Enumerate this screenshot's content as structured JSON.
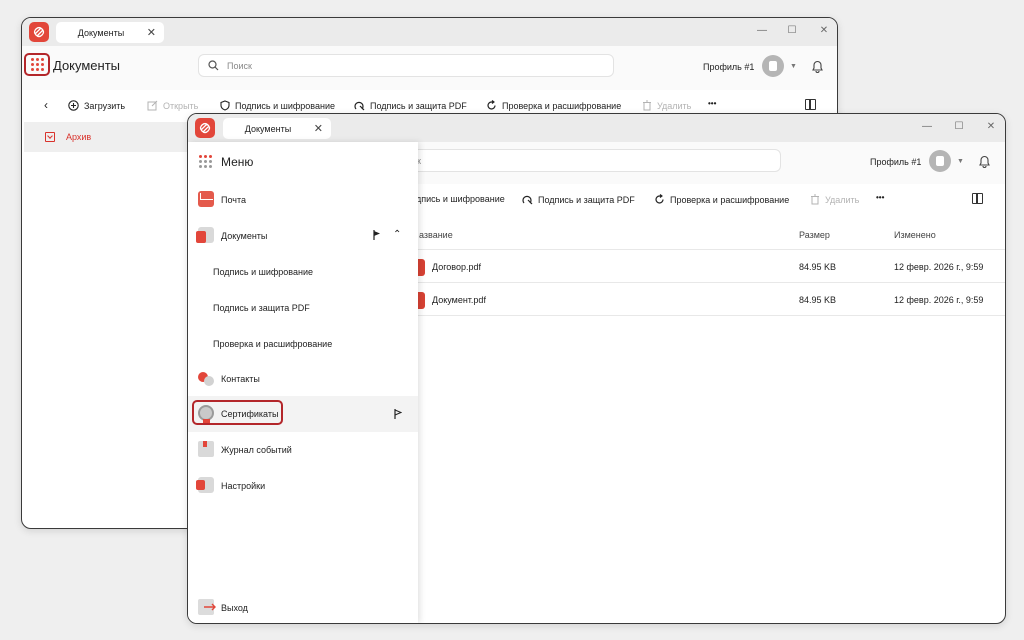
{
  "colors": {
    "accent": "#e2463a",
    "highlight": "#b3262a",
    "text": "#222222",
    "disabled": "#b3b3b3"
  },
  "back_window": {
    "tab": {
      "label": "Документы",
      "close": "✕"
    },
    "window_controls": {
      "minimize": "—",
      "maximize": "☐",
      "close": "✕"
    },
    "header": {
      "menu_icon": "grid-icon",
      "title": "Документы",
      "search_placeholder": "Поиск",
      "profile_name": "Профиль #1",
      "bell_icon": "bell-icon"
    },
    "toolbar": {
      "back": "‹",
      "upload": "Загрузить",
      "open": "Открыть",
      "sign_encrypt": "Подпись и шифрование",
      "sign_pdf": "Подпись и защита PDF",
      "verify_decrypt": "Проверка и расшифрование",
      "delete": "Удалить",
      "more": "•••"
    },
    "sidebar": {
      "archive_label": "Архив"
    }
  },
  "front_window": {
    "tab": {
      "label": "Документы",
      "close": "✕"
    },
    "window_controls": {
      "minimize": "—",
      "maximize": "☐",
      "close": "✕"
    },
    "header": {
      "search_partial": "к",
      "profile_name": "Профиль #1"
    },
    "toolbar": {
      "sign_encrypt_partial": "дпись и шифрование",
      "sign_pdf": "Подпись и защита PDF",
      "verify_decrypt": "Проверка и расшифрование",
      "delete": "Удалить",
      "more": "•••"
    },
    "table": {
      "columns": {
        "name_partial": "азвание",
        "size": "Размер",
        "modified": "Изменено"
      },
      "rows": [
        {
          "name": "Договор.pdf",
          "size": "84.95 KB",
          "modified": "12 февр. 2026 г., 9:59"
        },
        {
          "name": "Документ.pdf",
          "size": "84.95 KB",
          "modified": "12 февр. 2026 г., 9:59"
        }
      ]
    },
    "menu": {
      "title": "Меню",
      "items": [
        {
          "label": "Почта",
          "icon": "mail-icon"
        },
        {
          "label": "Документы",
          "icon": "documents-icon"
        },
        {
          "label": "Подпись и шифрование",
          "icon": ""
        },
        {
          "label": "Подпись и защита PDF",
          "icon": ""
        },
        {
          "label": "Проверка и расшифрование",
          "icon": ""
        },
        {
          "label": "Контакты",
          "icon": "contacts-icon"
        },
        {
          "label": "Сертификаты",
          "icon": "certificate-icon"
        },
        {
          "label": "Журнал событий",
          "icon": "journal-icon"
        },
        {
          "label": "Настройки",
          "icon": "settings-icon"
        }
      ],
      "exit_label": "Выход",
      "expand_chevron": "⌃"
    }
  }
}
